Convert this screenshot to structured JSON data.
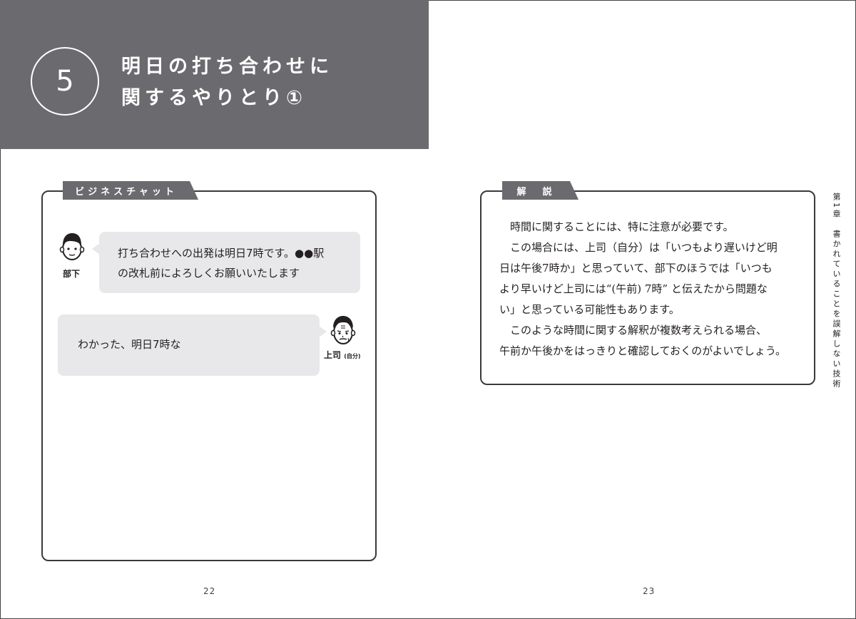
{
  "header": {
    "section_number": "5",
    "title_line1": "明日の打ち合わせに",
    "title_line2": "関するやりとり①"
  },
  "chat": {
    "tab_label": "ビジネスチャット",
    "message1": {
      "speaker": "部下",
      "line1": "打ち合わせへの出発は明日7時です。●●駅",
      "line2": "の改札前によろしくお願いいたします"
    },
    "message2": {
      "speaker": "上司",
      "speaker_note": "(自分)",
      "line1": "わかった、明日7時な"
    }
  },
  "explanation": {
    "tab_label": "解　説",
    "lines": [
      "時間に関することには、特に注意が必要です。",
      "この場合には、上司（自分）は「いつもより遅いけど明",
      "日は午後7時か」と思っていて、部下のほうでは「いつも",
      "より早いけど上司には“(午前) 7時” と伝えたから問題な",
      "い」と思っている可能性もあります。",
      "このような時間に関する解釈が複数考えられる場合、",
      "午前か午後かをはっきりと確認しておくのがよいでしょう。"
    ]
  },
  "chapter_label": "第1章　書かれていることを誤解しない技術",
  "page_numbers": {
    "left": "22",
    "right": "23"
  },
  "colors": {
    "band": "#6b6a6e",
    "bubble": "#e8e8ea",
    "text": "#231f20"
  }
}
